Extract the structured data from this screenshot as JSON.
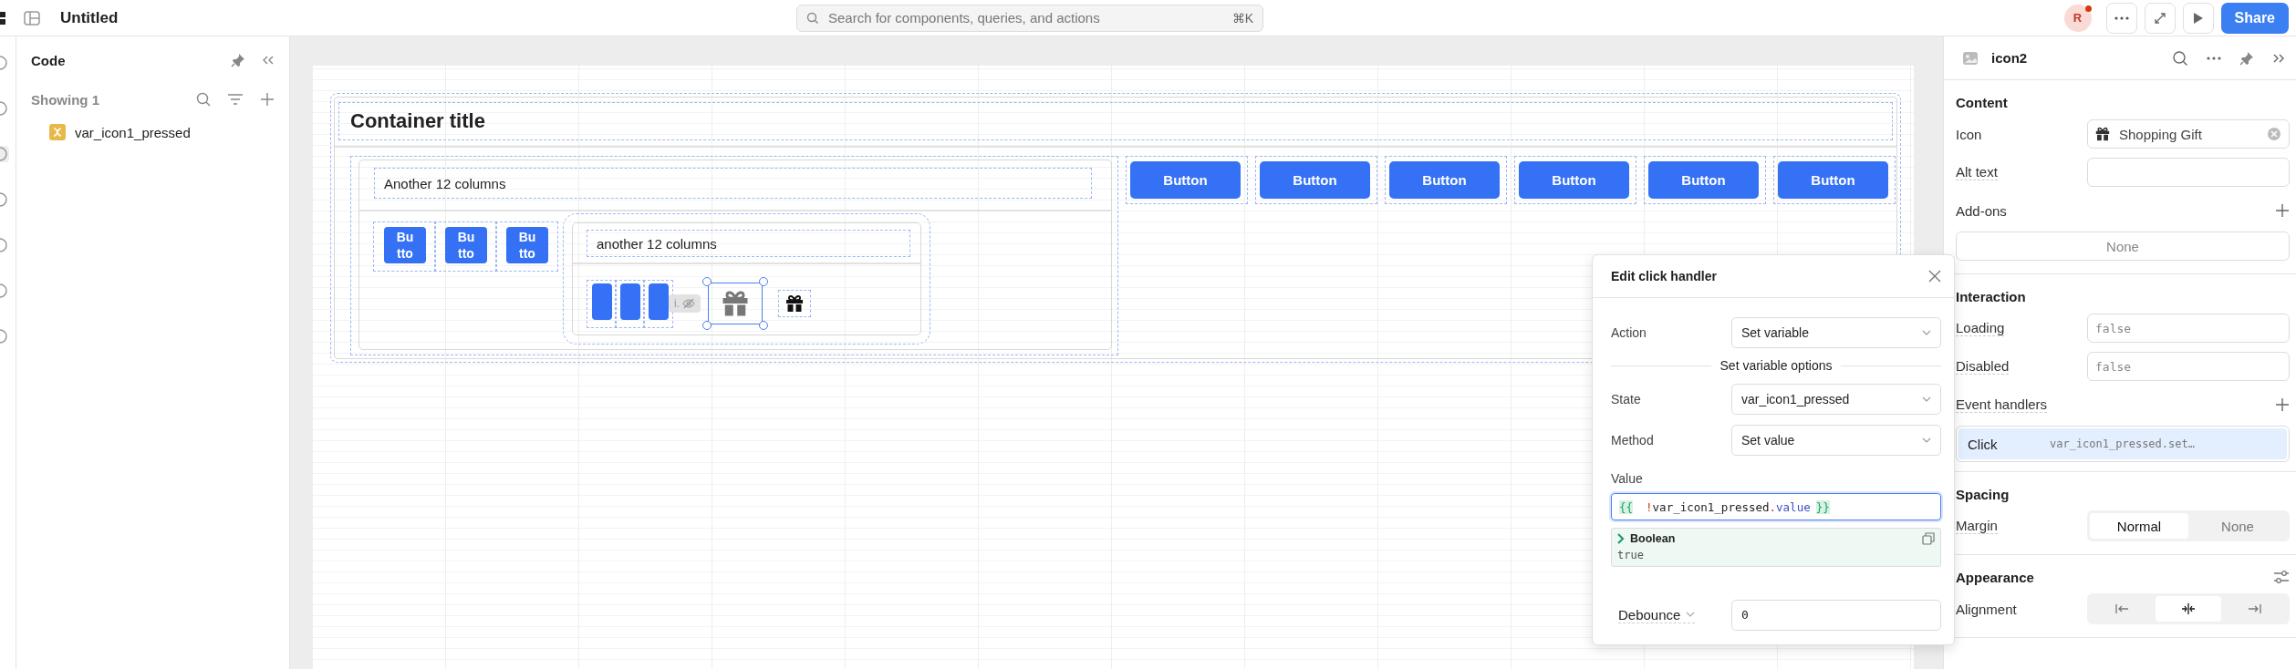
{
  "topbar": {
    "title": "Untitled",
    "search": {
      "placeholder": "Search for components, queries, and actions",
      "shortcut": "⌘K"
    },
    "avatar": "R",
    "share": "Share"
  },
  "code_panel": {
    "title": "Code",
    "count": "Showing 1",
    "items": [
      {
        "name": "var_icon1_pressed",
        "selected": false
      }
    ]
  },
  "canvas": {
    "container_title": "Container title",
    "left_column": {
      "title": "Another 12 columns",
      "small_buttons": [
        [
          "Bu",
          "tto"
        ],
        [
          "Bu",
          "tto"
        ],
        [
          "Bu",
          "tto"
        ]
      ],
      "nested": {
        "title": "another 12 columns",
        "items": [
          {
            "kind": "bar"
          },
          {
            "kind": "bar"
          },
          {
            "kind": "bar"
          },
          {
            "kind": "hidden_badge",
            "label": "i."
          },
          {
            "kind": "gift",
            "selected": true
          },
          {
            "kind": "gift",
            "selected": false
          }
        ]
      }
    },
    "buttons": [
      "Button",
      "Button",
      "Button",
      "Button",
      "Button",
      "Button"
    ]
  },
  "popup": {
    "title": "Edit click handler",
    "rows": [
      {
        "kind": "select",
        "label": "Action",
        "value": "Set variable"
      },
      {
        "kind": "divider",
        "label": "Set variable options"
      },
      {
        "kind": "select",
        "label": "State",
        "value": "var_icon1_pressed"
      },
      {
        "kind": "select",
        "label": "Method",
        "value": "Set value"
      },
      {
        "kind": "code",
        "label": "Value",
        "tokens": [
          {
            "kind": "brace",
            "text": "{{"
          },
          {
            "kind": "op",
            "text": "!"
          },
          {
            "kind": "plain",
            "text": "var_icon1_pressed"
          },
          {
            "kind": "op",
            "text": "."
          },
          {
            "kind": "prop",
            "text": "value"
          },
          {
            "kind": "brace",
            "text": "}}"
          }
        ],
        "preview": {
          "type": "Boolean",
          "value": "true"
        }
      },
      {
        "kind": "input",
        "label": "Debounce",
        "value": "0"
      }
    ]
  },
  "inspector": {
    "title": "icon2",
    "sections": [
      {
        "title": "Content",
        "settings": false,
        "rows": [
          {
            "kind": "icon_field",
            "label": "Icon",
            "hint": false,
            "value": "Shopping Gift"
          },
          {
            "kind": "field",
            "label": "Alt text",
            "hint": true
          },
          {
            "kind": "add",
            "label": "Add-ons",
            "hint": false
          },
          {
            "kind": "empty",
            "text": "None"
          }
        ]
      },
      {
        "title": "Interaction",
        "settings": false,
        "rows": [
          {
            "kind": "code",
            "label": "Loading",
            "hint": true,
            "placeholder": "false"
          },
          {
            "kind": "code",
            "label": "Disabled",
            "hint": true,
            "placeholder": "false"
          },
          {
            "kind": "add",
            "label": "Event handlers",
            "hint": true
          },
          {
            "kind": "handler",
            "event": "Click",
            "action": "var_icon1_pressed.set…",
            "selected": true
          }
        ]
      },
      {
        "title": "Spacing",
        "settings": false,
        "rows": [
          {
            "kind": "segmented",
            "label": "Margin",
            "hint": true,
            "options": [
              {
                "label": "Normal",
                "selected": true
              },
              {
                "label": "None",
                "selected": false
              }
            ]
          }
        ]
      },
      {
        "title": "Appearance",
        "settings": true,
        "rows": [
          {
            "kind": "icon_segmented",
            "label": "Alignment",
            "hint": false,
            "options": [
              {
                "kind": "left",
                "selected": false
              },
              {
                "kind": "center",
                "selected": true
              },
              {
                "kind": "right",
                "selected": false
              }
            ]
          }
        ]
      }
    ]
  }
}
